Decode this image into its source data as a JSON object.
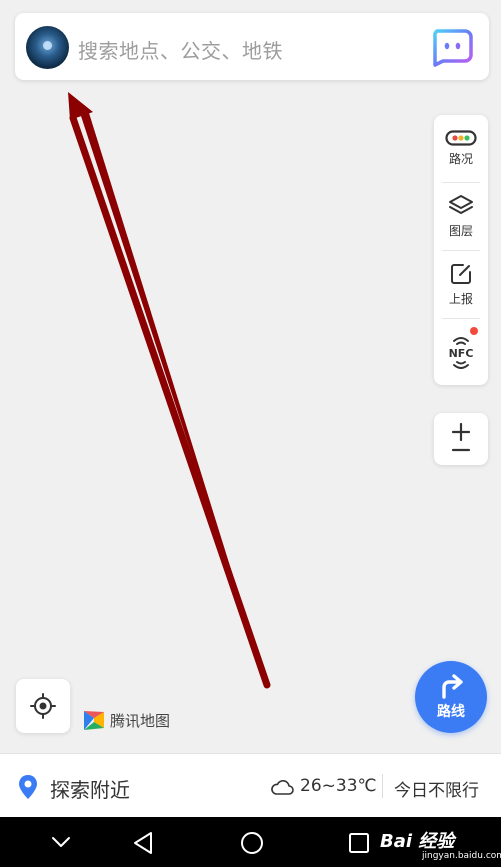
{
  "search": {
    "placeholder": "搜索地点、公交、地铁"
  },
  "tools": [
    {
      "label": "路况",
      "icon": "traffic-icon"
    },
    {
      "label": "图层",
      "icon": "layers-icon"
    },
    {
      "label": "上报",
      "icon": "report-icon"
    },
    {
      "label": "NFC",
      "icon": "nfc-icon"
    }
  ],
  "brand": {
    "name": "腾讯地图"
  },
  "route_button": {
    "label": "路线"
  },
  "bottom_bar": {
    "explore_label": "探索附近",
    "weather": "26~33℃",
    "restriction": "今日不限行"
  },
  "watermark": {
    "main": "Bai 经验",
    "sub": "jingyan.baidu.com"
  },
  "colors": {
    "accent": "#3b7cf5",
    "annotation_arrow": "#8b0000",
    "nfc_badge": "#f14b3b"
  }
}
